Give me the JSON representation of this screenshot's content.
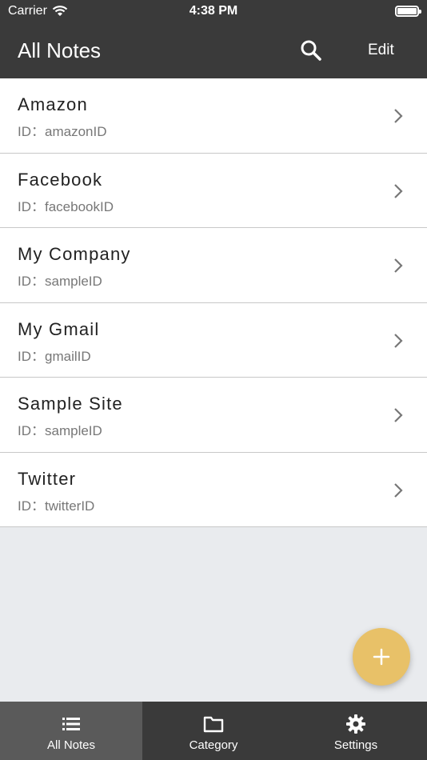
{
  "status_bar": {
    "carrier": "Carrier",
    "time": "4:38 PM"
  },
  "nav": {
    "title": "All Notes",
    "edit_label": "Edit"
  },
  "notes": [
    {
      "title": "Amazon",
      "subtitle": "ID：amazonID"
    },
    {
      "title": "Facebook",
      "subtitle": "ID：facebookID"
    },
    {
      "title": "My Company",
      "subtitle": "ID：sampleID"
    },
    {
      "title": "My Gmail",
      "subtitle": "ID：gmailID"
    },
    {
      "title": "Sample Site",
      "subtitle": "ID：sampleID"
    },
    {
      "title": "Twitter",
      "subtitle": "ID：twitterID"
    }
  ],
  "tabs": [
    {
      "label": "All Notes",
      "icon": "list-icon",
      "active": true
    },
    {
      "label": "Category",
      "icon": "folder-icon",
      "active": false
    },
    {
      "label": "Settings",
      "icon": "gear-icon",
      "active": false
    }
  ],
  "colors": {
    "bar": "#3a3a3a",
    "active_tab": "#5a5a5a",
    "fab": "#e8c168",
    "background": "#e9ebee"
  }
}
